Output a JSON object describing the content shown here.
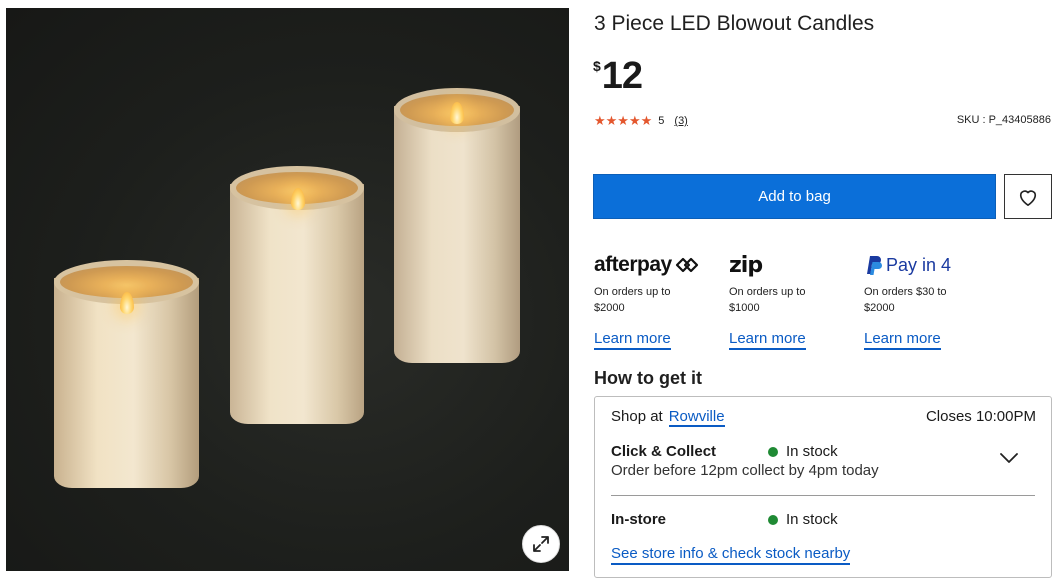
{
  "product": {
    "title": "3 Piece LED Blowout Candles",
    "currency_symbol": "$",
    "price": "12",
    "rating_stars": "★★★★★",
    "rating_value": "5",
    "review_count": "(3)",
    "sku": "SKU : P_43405886"
  },
  "actions": {
    "add_to_bag": "Add to bag"
  },
  "payments": [
    {
      "logo_text": "afterpay",
      "desc": "On orders up to $2000",
      "learn": "Learn more"
    },
    {
      "logo_text": "zip",
      "desc": "On orders up to $1000",
      "learn": "Learn more"
    },
    {
      "logo_text": "Pay in 4",
      "desc": "On orders $30 to $2000",
      "learn": "Learn more"
    }
  ],
  "fulfilment": {
    "heading": "How to get it",
    "shop_at_label": "Shop at",
    "store_name": "Rowville",
    "closes": "Closes 10:00PM",
    "click_collect": {
      "title": "Click & Collect",
      "status": "In stock",
      "note": "Order before 12pm collect by 4pm today"
    },
    "in_store": {
      "title": "In-store",
      "status": "In stock"
    },
    "store_info_link": "See store info & check stock nearby"
  },
  "colors": {
    "primary_blue": "#0b6fd9",
    "link_blue": "#0a5bc4",
    "star_orange": "#e4572e",
    "in_stock_green": "#1f8a34"
  },
  "icons": [
    "expand-icon",
    "heart-icon",
    "chevron-down-icon",
    "star-icon",
    "paypal-icon",
    "in-stock-dot-icon"
  ]
}
